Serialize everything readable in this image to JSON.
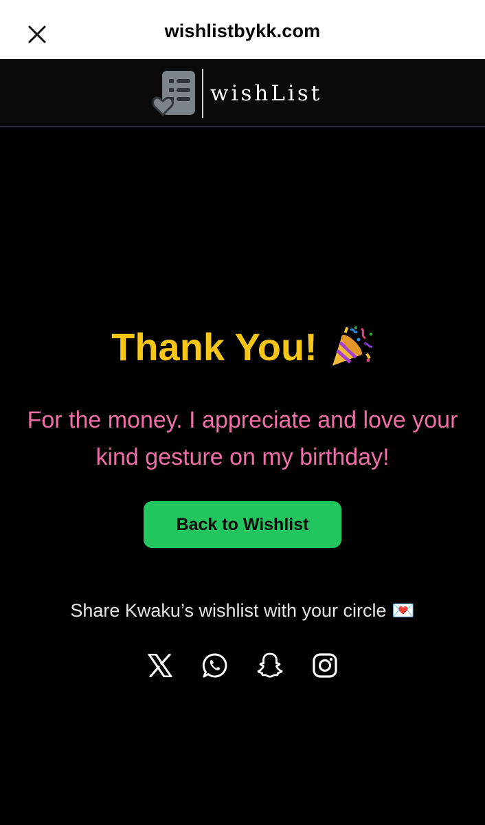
{
  "browser": {
    "url": "wishlistbykk.com",
    "close_icon": "close-icon"
  },
  "header": {
    "brand_name": "wishList",
    "logo_icon": "wishlist-heart-doc-icon"
  },
  "main": {
    "title": "Thank You!",
    "title_emoji": "🎉",
    "message": "For the money. I appreciate and love your kind gesture on my birthday!",
    "back_button": "Back to Wishlist",
    "share_text": "Share Kwaku’s wishlist with your circle 💌"
  },
  "social": [
    {
      "name": "x",
      "icon": "x-icon"
    },
    {
      "name": "whatsapp",
      "icon": "whatsapp-icon"
    },
    {
      "name": "snapchat",
      "icon": "snapchat-icon"
    },
    {
      "name": "instagram",
      "icon": "instagram-icon"
    }
  ],
  "colors": {
    "title": "#f5c518",
    "message": "#f06fa8",
    "button": "#22c55e",
    "background": "#000000"
  }
}
